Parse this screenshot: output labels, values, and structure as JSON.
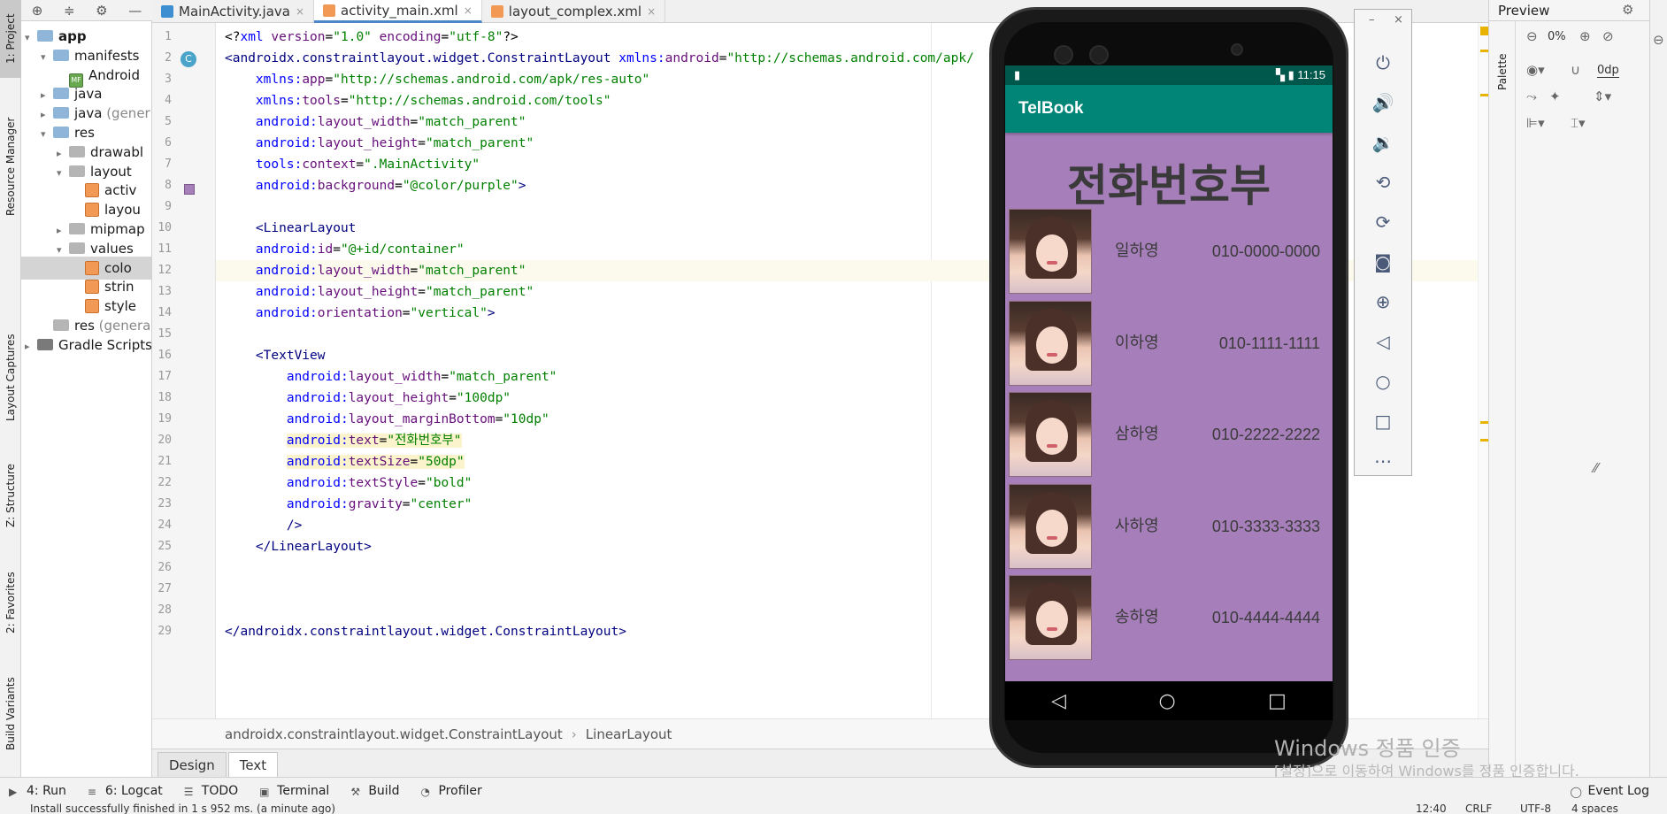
{
  "left_tabs": {
    "project": "1: Project",
    "resource_manager": "Resource Manager",
    "layout_captures": "Layout Captures",
    "structure": "Z: Structure",
    "favorites": "2: Favorites",
    "build_variants": "Build Variants"
  },
  "project_tree": [
    {
      "label": "app",
      "indent": 0,
      "icon": "folder",
      "arrow": "▾",
      "bold": true
    },
    {
      "label": "manifests",
      "indent": 1,
      "icon": "folder",
      "arrow": "▾"
    },
    {
      "label": "Android",
      "indent": 2,
      "icon": "file-mf",
      "arrow": ""
    },
    {
      "label": "java",
      "indent": 1,
      "icon": "folder",
      "arrow": "▸"
    },
    {
      "label": "java",
      "suffix": "(gener",
      "indent": 1,
      "icon": "folder",
      "arrow": "▸"
    },
    {
      "label": "res",
      "indent": 1,
      "icon": "folder",
      "arrow": "▾"
    },
    {
      "label": "drawabl",
      "indent": 2,
      "icon": "folder-gray",
      "arrow": "▸"
    },
    {
      "label": "layout",
      "indent": 2,
      "icon": "folder-gray",
      "arrow": "▾"
    },
    {
      "label": "activ",
      "indent": 3,
      "icon": "file-xml",
      "arrow": ""
    },
    {
      "label": "layou",
      "indent": 3,
      "icon": "file-xml",
      "arrow": ""
    },
    {
      "label": "mipmap",
      "indent": 2,
      "icon": "folder-gray",
      "arrow": "▸"
    },
    {
      "label": "values",
      "indent": 2,
      "icon": "folder-gray",
      "arrow": "▾"
    },
    {
      "label": "colo",
      "indent": 3,
      "icon": "file-xml",
      "arrow": "",
      "selected": true
    },
    {
      "label": "strin",
      "indent": 3,
      "icon": "file-xml",
      "arrow": ""
    },
    {
      "label": "style",
      "indent": 3,
      "icon": "file-xml",
      "arrow": ""
    },
    {
      "label": "res",
      "suffix": "(genera",
      "indent": 1,
      "icon": "folder-gray",
      "arrow": ""
    },
    {
      "label": "Gradle Scripts",
      "indent": 0,
      "icon": "gradle",
      "arrow": "▸"
    }
  ],
  "tabs": [
    {
      "label": "MainActivity.java",
      "icon_color": "#3d8fd1",
      "active": false
    },
    {
      "label": "activity_main.xml",
      "icon_color": "#f29a55",
      "active": true
    },
    {
      "label": "layout_complex.xml",
      "icon_color": "#f29a55",
      "active": false
    }
  ],
  "code_lines": [
    {
      "n": "1",
      "indent": 0,
      "parts": [
        [
          "plain",
          "<?"
        ],
        [
          "ns",
          "xml"
        ],
        [
          "plain",
          " "
        ],
        [
          "attr",
          "version"
        ],
        [
          "plain",
          "="
        ],
        [
          "val",
          "\"1.0\""
        ],
        [
          "plain",
          " "
        ],
        [
          "attr",
          "encoding"
        ],
        [
          "plain",
          "="
        ],
        [
          "val",
          "\"utf-8\""
        ],
        [
          "plain",
          "?>"
        ]
      ]
    },
    {
      "n": "2",
      "indent": 0,
      "parts": [
        [
          "tag",
          "<androidx.constraintlayout.widget.ConstraintLayout "
        ],
        [
          "ns",
          "xmlns:"
        ],
        [
          "attr",
          "android"
        ],
        [
          "plain",
          "="
        ],
        [
          "val",
          "\"http://schemas.android.com/apk/"
        ]
      ]
    },
    {
      "n": "3",
      "indent": 2,
      "parts": [
        [
          "ns",
          "xmlns:"
        ],
        [
          "attr",
          "app"
        ],
        [
          "plain",
          "="
        ],
        [
          "val",
          "\"http://schemas.android.com/apk/res-auto\""
        ]
      ]
    },
    {
      "n": "4",
      "indent": 2,
      "parts": [
        [
          "ns",
          "xmlns:"
        ],
        [
          "attr",
          "tools"
        ],
        [
          "plain",
          "="
        ],
        [
          "val",
          "\"http://schemas.android.com/tools\""
        ]
      ]
    },
    {
      "n": "5",
      "indent": 2,
      "parts": [
        [
          "ns",
          "android:"
        ],
        [
          "attr",
          "layout_width"
        ],
        [
          "plain",
          "="
        ],
        [
          "val",
          "\"match_parent\""
        ]
      ]
    },
    {
      "n": "6",
      "indent": 2,
      "parts": [
        [
          "ns",
          "android:"
        ],
        [
          "attr",
          "layout_height"
        ],
        [
          "plain",
          "="
        ],
        [
          "val",
          "\"match_parent\""
        ]
      ]
    },
    {
      "n": "7",
      "indent": 2,
      "parts": [
        [
          "ns",
          "tools:"
        ],
        [
          "attr",
          "context"
        ],
        [
          "plain",
          "="
        ],
        [
          "val",
          "\".MainActivity\""
        ]
      ]
    },
    {
      "n": "8",
      "indent": 2,
      "parts": [
        [
          "ns",
          "android:"
        ],
        [
          "attr",
          "background"
        ],
        [
          "plain",
          "="
        ],
        [
          "val",
          "\"@color/purple\""
        ],
        [
          "tag",
          ">"
        ]
      ]
    },
    {
      "n": "9",
      "indent": 0,
      "parts": []
    },
    {
      "n": "10",
      "indent": 2,
      "parts": [
        [
          "tag",
          "<LinearLayout"
        ]
      ]
    },
    {
      "n": "11",
      "indent": 2,
      "parts": [
        [
          "ns",
          "android:"
        ],
        [
          "attr",
          "id"
        ],
        [
          "plain",
          "="
        ],
        [
          "val",
          "\"@+id/container\""
        ]
      ]
    },
    {
      "n": "12",
      "indent": 2,
      "parts": [
        [
          "ns",
          "android:"
        ],
        [
          "attr",
          "layout_width"
        ],
        [
          "plain",
          "="
        ],
        [
          "val",
          "\"match_parent\""
        ]
      ],
      "current": true
    },
    {
      "n": "13",
      "indent": 2,
      "parts": [
        [
          "ns",
          "android:"
        ],
        [
          "attr",
          "layout_height"
        ],
        [
          "plain",
          "="
        ],
        [
          "val",
          "\"match_parent\""
        ]
      ]
    },
    {
      "n": "14",
      "indent": 2,
      "parts": [
        [
          "ns",
          "android:"
        ],
        [
          "attr",
          "orientation"
        ],
        [
          "plain",
          "="
        ],
        [
          "val",
          "\"vertical\""
        ],
        [
          "tag",
          ">"
        ]
      ]
    },
    {
      "n": "15",
      "indent": 0,
      "parts": []
    },
    {
      "n": "16",
      "indent": 2,
      "parts": [
        [
          "tag",
          "<TextView"
        ]
      ]
    },
    {
      "n": "17",
      "indent": 4,
      "parts": [
        [
          "ns",
          "android:"
        ],
        [
          "attr",
          "layout_width"
        ],
        [
          "plain",
          "="
        ],
        [
          "val",
          "\"match_parent\""
        ]
      ]
    },
    {
      "n": "18",
      "indent": 4,
      "parts": [
        [
          "ns",
          "android:"
        ],
        [
          "attr",
          "layout_height"
        ],
        [
          "plain",
          "="
        ],
        [
          "val",
          "\"100dp\""
        ]
      ]
    },
    {
      "n": "19",
      "indent": 4,
      "parts": [
        [
          "ns",
          "android:"
        ],
        [
          "attr",
          "layout_marginBottom"
        ],
        [
          "plain",
          "="
        ],
        [
          "val",
          "\"10dp\""
        ]
      ]
    },
    {
      "n": "20",
      "indent": 4,
      "parts": [
        [
          "ns",
          "android:"
        ],
        [
          "attr",
          "text"
        ],
        [
          "plain",
          "="
        ],
        [
          "val",
          "\"전화번호부\""
        ]
      ],
      "warn": true
    },
    {
      "n": "21",
      "indent": 4,
      "parts": [
        [
          "ns",
          "android:"
        ],
        [
          "attr",
          "textSize"
        ],
        [
          "plain",
          "="
        ],
        [
          "val",
          "\"50dp\""
        ]
      ],
      "warn": true
    },
    {
      "n": "22",
      "indent": 4,
      "parts": [
        [
          "ns",
          "android:"
        ],
        [
          "attr",
          "textStyle"
        ],
        [
          "plain",
          "="
        ],
        [
          "val",
          "\"bold\""
        ]
      ]
    },
    {
      "n": "23",
      "indent": 4,
      "parts": [
        [
          "ns",
          "android:"
        ],
        [
          "attr",
          "gravity"
        ],
        [
          "plain",
          "="
        ],
        [
          "val",
          "\"center\""
        ]
      ]
    },
    {
      "n": "24",
      "indent": 4,
      "parts": [
        [
          "tag",
          "/>"
        ]
      ]
    },
    {
      "n": "25",
      "indent": 2,
      "parts": [
        [
          "tag",
          "</LinearLayout>"
        ]
      ]
    },
    {
      "n": "26",
      "indent": 0,
      "parts": []
    },
    {
      "n": "27",
      "indent": 0,
      "parts": []
    },
    {
      "n": "28",
      "indent": 0,
      "parts": []
    },
    {
      "n": "29",
      "indent": 0,
      "parts": [
        [
          "tag",
          "</androidx.constraintlayout.widget.ConstraintLayout>"
        ]
      ]
    }
  ],
  "breadcrumb": [
    "androidx.constraintlayout.widget.ConstraintLayout",
    "LinearLayout"
  ],
  "design_tabs": [
    {
      "label": "Design",
      "active": false
    },
    {
      "label": "Text",
      "active": true
    }
  ],
  "bottom_tools": [
    {
      "label": "4: Run",
      "icon": "run-icon"
    },
    {
      "label": "6: Logcat",
      "icon": "logcat-icon"
    },
    {
      "label": "TODO",
      "icon": "todo-icon"
    },
    {
      "label": "Terminal",
      "icon": "terminal-icon"
    },
    {
      "label": "Build",
      "icon": "build-icon"
    },
    {
      "label": "Profiler",
      "icon": "profiler-icon"
    }
  ],
  "event_log": "Event Log",
  "status": {
    "message": "Install successfully finished in 1 s 952 ms. (a minute ago)",
    "position": "12:40",
    "line_sep": "CRLF",
    "encoding": "UTF-8",
    "indent": "4 spaces"
  },
  "phone": {
    "time": "11:15",
    "app_title": "TelBook",
    "heading": "전화번호부",
    "contacts": [
      {
        "name": "일하영",
        "number": "010-0000-0000"
      },
      {
        "name": "이하영",
        "number": "010-1111-1111"
      },
      {
        "name": "삼하영",
        "number": "010-2222-2222"
      },
      {
        "name": "사하영",
        "number": "010-3333-3333"
      },
      {
        "name": "송하영",
        "number": "010-4444-4444"
      }
    ]
  },
  "emulator_tools": [
    "power-icon",
    "volume-up-icon",
    "volume-down-icon",
    "rotate-left-icon",
    "rotate-right-icon",
    "camera-icon",
    "zoom-icon",
    "back-icon",
    "home-icon",
    "overview-icon",
    "more-icon"
  ],
  "preview": {
    "title": "Preview",
    "palette": "Palette",
    "zoom": "0%",
    "margin": "0dp"
  },
  "watermark": {
    "line1": "Windows 정품 인증",
    "line2": "[설정]으로 이동하여 Windows를 정품 인증합니다."
  },
  "colors": {
    "accent": "#008577",
    "status_bar": "#00574b",
    "screen_bg": "#a67fba"
  }
}
